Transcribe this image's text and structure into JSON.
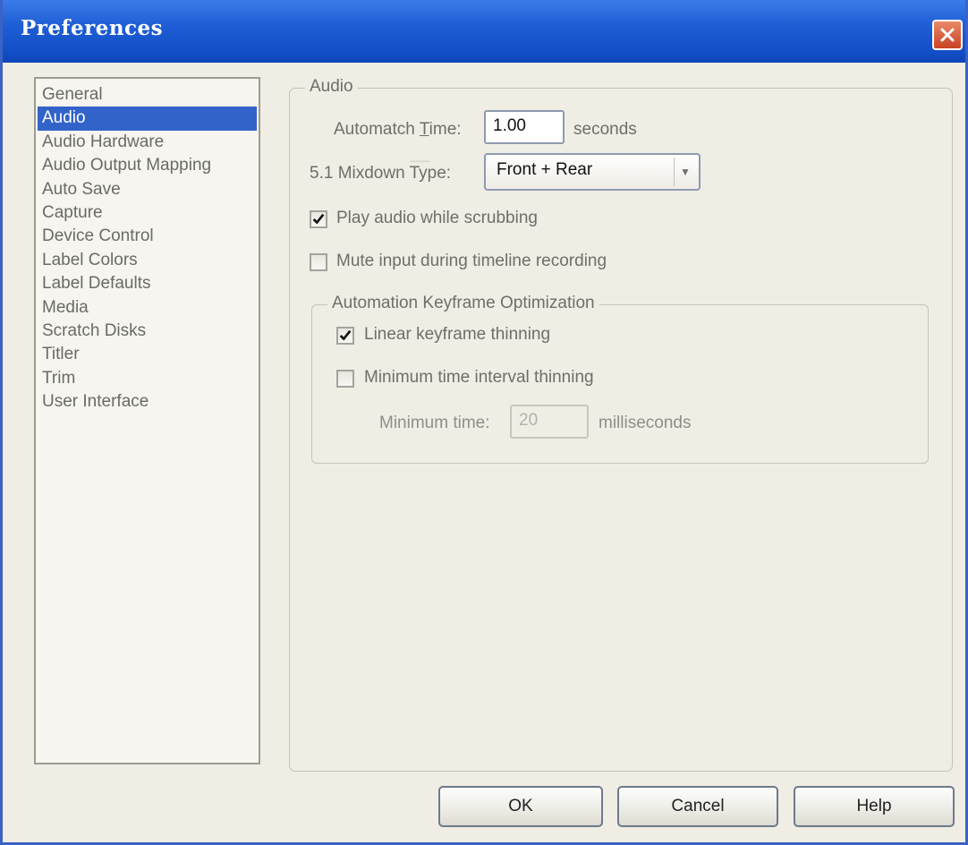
{
  "window": {
    "title": "Preferences",
    "close_icon": "close-icon"
  },
  "sidebar": {
    "items": [
      {
        "label": "General",
        "selected": false
      },
      {
        "label": "Audio",
        "selected": true
      },
      {
        "label": "Audio Hardware",
        "selected": false
      },
      {
        "label": "Audio Output Mapping",
        "selected": false
      },
      {
        "label": "Auto Save",
        "selected": false
      },
      {
        "label": "Capture",
        "selected": false
      },
      {
        "label": "Device Control",
        "selected": false
      },
      {
        "label": "Label Colors",
        "selected": false
      },
      {
        "label": "Label Defaults",
        "selected": false
      },
      {
        "label": "Media",
        "selected": false
      },
      {
        "label": "Scratch Disks",
        "selected": false
      },
      {
        "label": "Titler",
        "selected": false
      },
      {
        "label": "Trim",
        "selected": false
      },
      {
        "label": "User Interface",
        "selected": false
      }
    ]
  },
  "audio": {
    "group_title": "Audio",
    "automatch_label_pre": "Automatch ",
    "automatch_label_key": "T",
    "automatch_label_post": "ime:",
    "automatch_value": "1.00",
    "automatch_unit": "seconds",
    "mixdown_label": "5.1 Mixdown Type:",
    "mixdown_value": "Front + Rear",
    "play_while_scrubbing": {
      "label": "Play audio while scrubbing",
      "checked": true
    },
    "mute_input": {
      "label": "Mute input during timeline recording",
      "checked": false
    }
  },
  "optimization": {
    "group_title": "Automation Keyframe Optimization",
    "linear_thinning": {
      "label": "Linear keyframe thinning",
      "checked": true
    },
    "min_interval_thinning": {
      "label": "Minimum time interval thinning",
      "checked": false
    },
    "min_time_label": "Minimum time:",
    "min_time_value": "20",
    "min_time_unit": "milliseconds"
  },
  "buttons": {
    "ok": "OK",
    "cancel": "Cancel",
    "help": "Help"
  },
  "colors": {
    "title_bar": "#1f5ed6",
    "selection": "#3263c8",
    "close_button": "#d8552f"
  }
}
